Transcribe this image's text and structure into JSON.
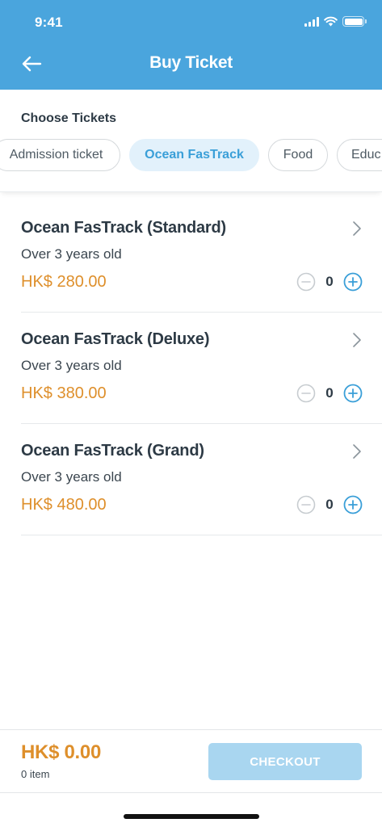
{
  "status_bar": {
    "time": "9:41"
  },
  "header": {
    "title": "Buy Ticket",
    "back_icon": "arrow-left-icon"
  },
  "colors": {
    "header_bg": "#4aa5dd",
    "price": "#de8f2b",
    "accent": "#3a9fd8",
    "checkout_disabled": "#a9d6f0"
  },
  "choose": {
    "label": "Choose Tickets",
    "chips": [
      {
        "label": "Admission ticket",
        "active": false
      },
      {
        "label": "Ocean FasTrack",
        "active": true
      },
      {
        "label": "Food",
        "active": false
      },
      {
        "label": "Educ",
        "active": false
      }
    ]
  },
  "tickets": [
    {
      "name": "Ocean FasTrack (Standard)",
      "subtitle": "Over 3 years old",
      "price": "HK$ 280.00",
      "qty": "0"
    },
    {
      "name": "Ocean FasTrack (Deluxe)",
      "subtitle": "Over 3 years old",
      "price": "HK$ 380.00",
      "qty": "0"
    },
    {
      "name": "Ocean FasTrack (Grand)",
      "subtitle": "Over 3 years old",
      "price": "HK$ 480.00",
      "qty": "0"
    }
  ],
  "footer": {
    "total": "HK$ 0.00",
    "count": "0 item",
    "checkout_label": "CHECKOUT"
  }
}
